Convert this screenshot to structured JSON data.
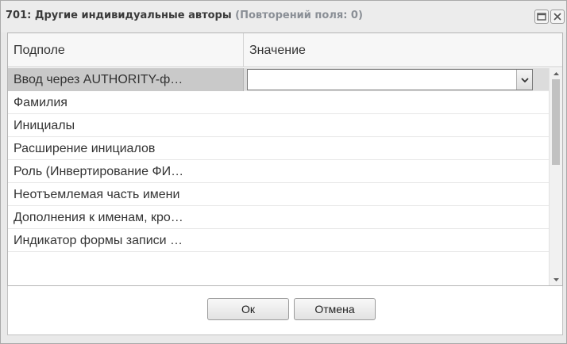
{
  "dialog": {
    "title": "701: Другие индивидуальные авторы",
    "title_count": "(Повторений поля: 0)",
    "maximize_icon": "window-maximize-icon",
    "close_icon": "close-icon"
  },
  "grid": {
    "columns": [
      "Подполе",
      "Значение"
    ],
    "rows": [
      {
        "label": "Ввод через AUTHORITY-ф…",
        "value": ""
      },
      {
        "label": "Фамилия",
        "value": ""
      },
      {
        "label": "Инициалы",
        "value": ""
      },
      {
        "label": "Расширение инициалов",
        "value": ""
      },
      {
        "label": "Роль (Инвертирование ФИ…",
        "value": ""
      },
      {
        "label": "Неотъемлемая часть имени",
        "value": ""
      },
      {
        "label": "Дополнения к именам, кро…",
        "value": ""
      },
      {
        "label": "Индикатор формы записи …",
        "value": ""
      }
    ],
    "selected_row": 0,
    "scroll_position": 0
  },
  "buttons": {
    "ok": "Ок",
    "cancel": "Отмена"
  },
  "colors": {
    "selected_row": "#c9c9c9",
    "header_bg": "#f7f7f7",
    "title_count": "#8a8f96"
  }
}
